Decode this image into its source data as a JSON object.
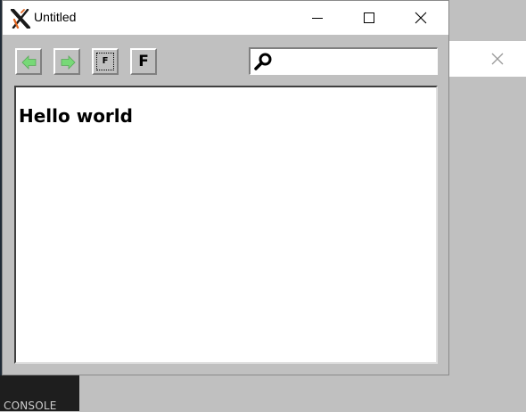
{
  "window": {
    "title": "Untitled"
  },
  "toolbar": {
    "back_icon": "arrow-left-icon",
    "forward_icon": "arrow-right-icon",
    "font_small_label": "F",
    "font_large_label": "F",
    "search": {
      "icon": "magnifier-icon",
      "value": "",
      "placeholder": ""
    }
  },
  "content": {
    "text": "Hello world"
  },
  "background": {
    "console_label": "CONSOLE",
    "close_icon": "close-icon"
  },
  "colors": {
    "chrome_gray": "#c0c0c0",
    "arrow_green": "#77d977",
    "ide_dark": "#1f2a36"
  }
}
